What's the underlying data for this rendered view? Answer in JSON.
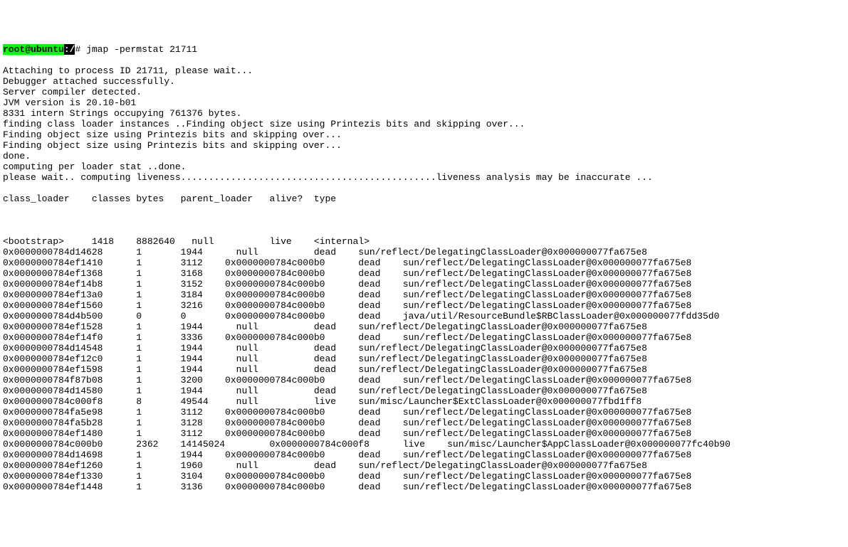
{
  "prompt": {
    "user": "root@ubuntu",
    "sep": ":",
    "path": "/",
    "hash": "#",
    "command": " jmap -permstat 21711"
  },
  "preamble": [
    "Attaching to process ID 21711, please wait...",
    "Debugger attached successfully.",
    "Server compiler detected.",
    "JVM version is 20.10-b01",
    "8331 intern Strings occupying 761376 bytes.",
    "finding class loader instances ..Finding object size using Printezis bits and skipping over...",
    "Finding object size using Printezis bits and skipping over...",
    "Finding object size using Printezis bits and skipping over...",
    "done.",
    "computing per loader stat ..done.",
    "please wait.. computing liveness..............................................liveness analysis may be inaccurate ..."
  ],
  "header": "class_loader    classes bytes   parent_loader   alive?  type",
  "rows": [
    "<bootstrap>     1418    8882640   null          live    <internal>",
    "0x0000000784d14628      1       1944      null          dead    sun/reflect/DelegatingClassLoader@0x000000077fa675e8",
    "0x0000000784ef1410      1       3112    0x0000000784c000b0      dead    sun/reflect/DelegatingClassLoader@0x000000077fa675e8",
    "0x0000000784ef1368      1       3168    0x0000000784c000b0      dead    sun/reflect/DelegatingClassLoader@0x000000077fa675e8",
    "0x0000000784ef14b8      1       3152    0x0000000784c000b0      dead    sun/reflect/DelegatingClassLoader@0x000000077fa675e8",
    "0x0000000784ef13a0      1       3184    0x0000000784c000b0      dead    sun/reflect/DelegatingClassLoader@0x000000077fa675e8",
    "0x0000000784ef1560      1       3216    0x0000000784c000b0      dead    sun/reflect/DelegatingClassLoader@0x000000077fa675e8",
    "0x0000000784d4b500      0       0       0x0000000784c000b0      dead    java/util/ResourceBundle$RBClassLoader@0x000000077fdd35d0",
    "0x0000000784ef1528      1       1944      null          dead    sun/reflect/DelegatingClassLoader@0x000000077fa675e8",
    "0x0000000784ef14f0      1       3336    0x0000000784c000b0      dead    sun/reflect/DelegatingClassLoader@0x000000077fa675e8",
    "0x0000000784d14548      1       1944      null          dead    sun/reflect/DelegatingClassLoader@0x000000077fa675e8",
    "0x0000000784ef12c0      1       1944      null          dead    sun/reflect/DelegatingClassLoader@0x000000077fa675e8",
    "0x0000000784ef1598      1       1944      null          dead    sun/reflect/DelegatingClassLoader@0x000000077fa675e8",
    "0x0000000784f87b08      1       3200    0x0000000784c000b0      dead    sun/reflect/DelegatingClassLoader@0x000000077fa675e8",
    "0x0000000784d14580      1       1944      null          dead    sun/reflect/DelegatingClassLoader@0x000000077fa675e8",
    "0x0000000784c000f8      8       49544     null          live    sun/misc/Launcher$ExtClassLoader@0x000000077fbd1ff8",
    "0x0000000784fa5e98      1       3112    0x0000000784c000b0      dead    sun/reflect/DelegatingClassLoader@0x000000077fa675e8",
    "0x0000000784fa5b28      1       3128    0x0000000784c000b0      dead    sun/reflect/DelegatingClassLoader@0x000000077fa675e8",
    "0x0000000784ef1480      1       3112    0x0000000784c000b0      dead    sun/reflect/DelegatingClassLoader@0x000000077fa675e8",
    "0x0000000784c000b0      2362    14145024        0x0000000784c000f8      live    sun/misc/Launcher$AppClassLoader@0x000000077fc40b90",
    "0x0000000784d14698      1       1944    0x0000000784c000b0      dead    sun/reflect/DelegatingClassLoader@0x000000077fa675e8",
    "0x0000000784ef1260      1       1960      null          dead    sun/reflect/DelegatingClassLoader@0x000000077fa675e8",
    "0x0000000784ef1330      1       3104    0x0000000784c000b0      dead    sun/reflect/DelegatingClassLoader@0x000000077fa675e8",
    "0x0000000784ef1448      1       3136    0x0000000784c000b0      dead    sun/reflect/DelegatingClassLoader@0x000000077fa675e8"
  ]
}
